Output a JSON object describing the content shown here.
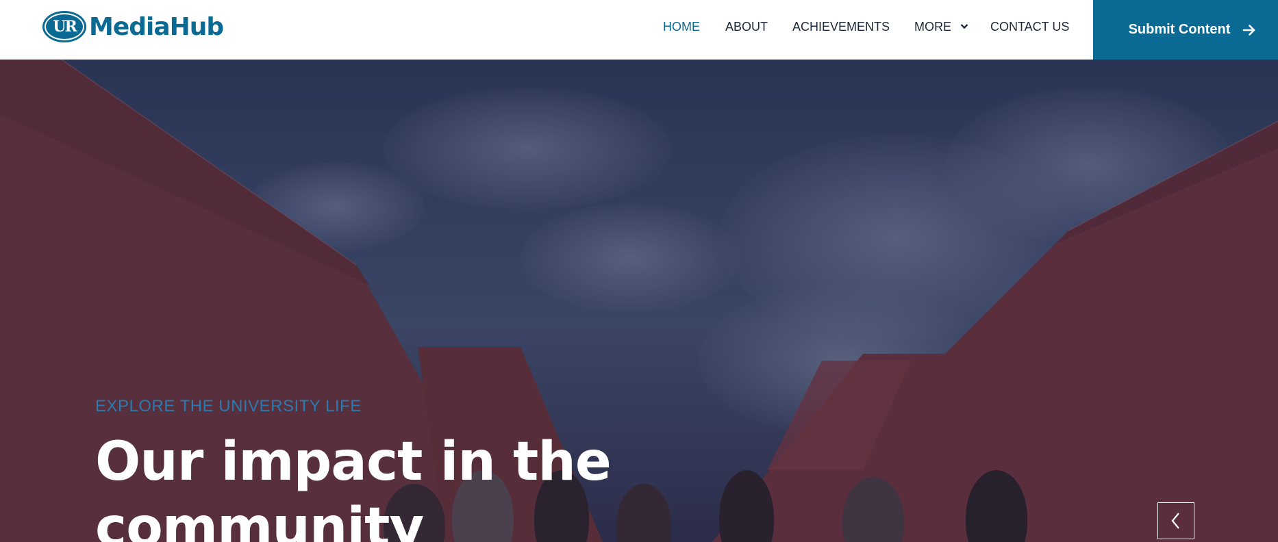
{
  "brand": {
    "logo_mark": "UR",
    "name": "MediaHub",
    "color": "#0b6a94"
  },
  "nav": {
    "items": [
      {
        "label": "HOME",
        "active": true
      },
      {
        "label": "ABOUT",
        "active": false
      },
      {
        "label": "ACHIEVEMENTS",
        "active": false
      },
      {
        "label": "MORE",
        "active": false,
        "has_dropdown": true
      },
      {
        "label": "CONTACT US",
        "active": false
      }
    ]
  },
  "cta": {
    "label": "Submit Content",
    "icon": "arrow-right-icon"
  },
  "hero": {
    "kicker": "EXPLORE THE UNIVERSITY LIFE",
    "headline": "Our impact in the community",
    "prev_icon": "chevron-left-icon"
  }
}
